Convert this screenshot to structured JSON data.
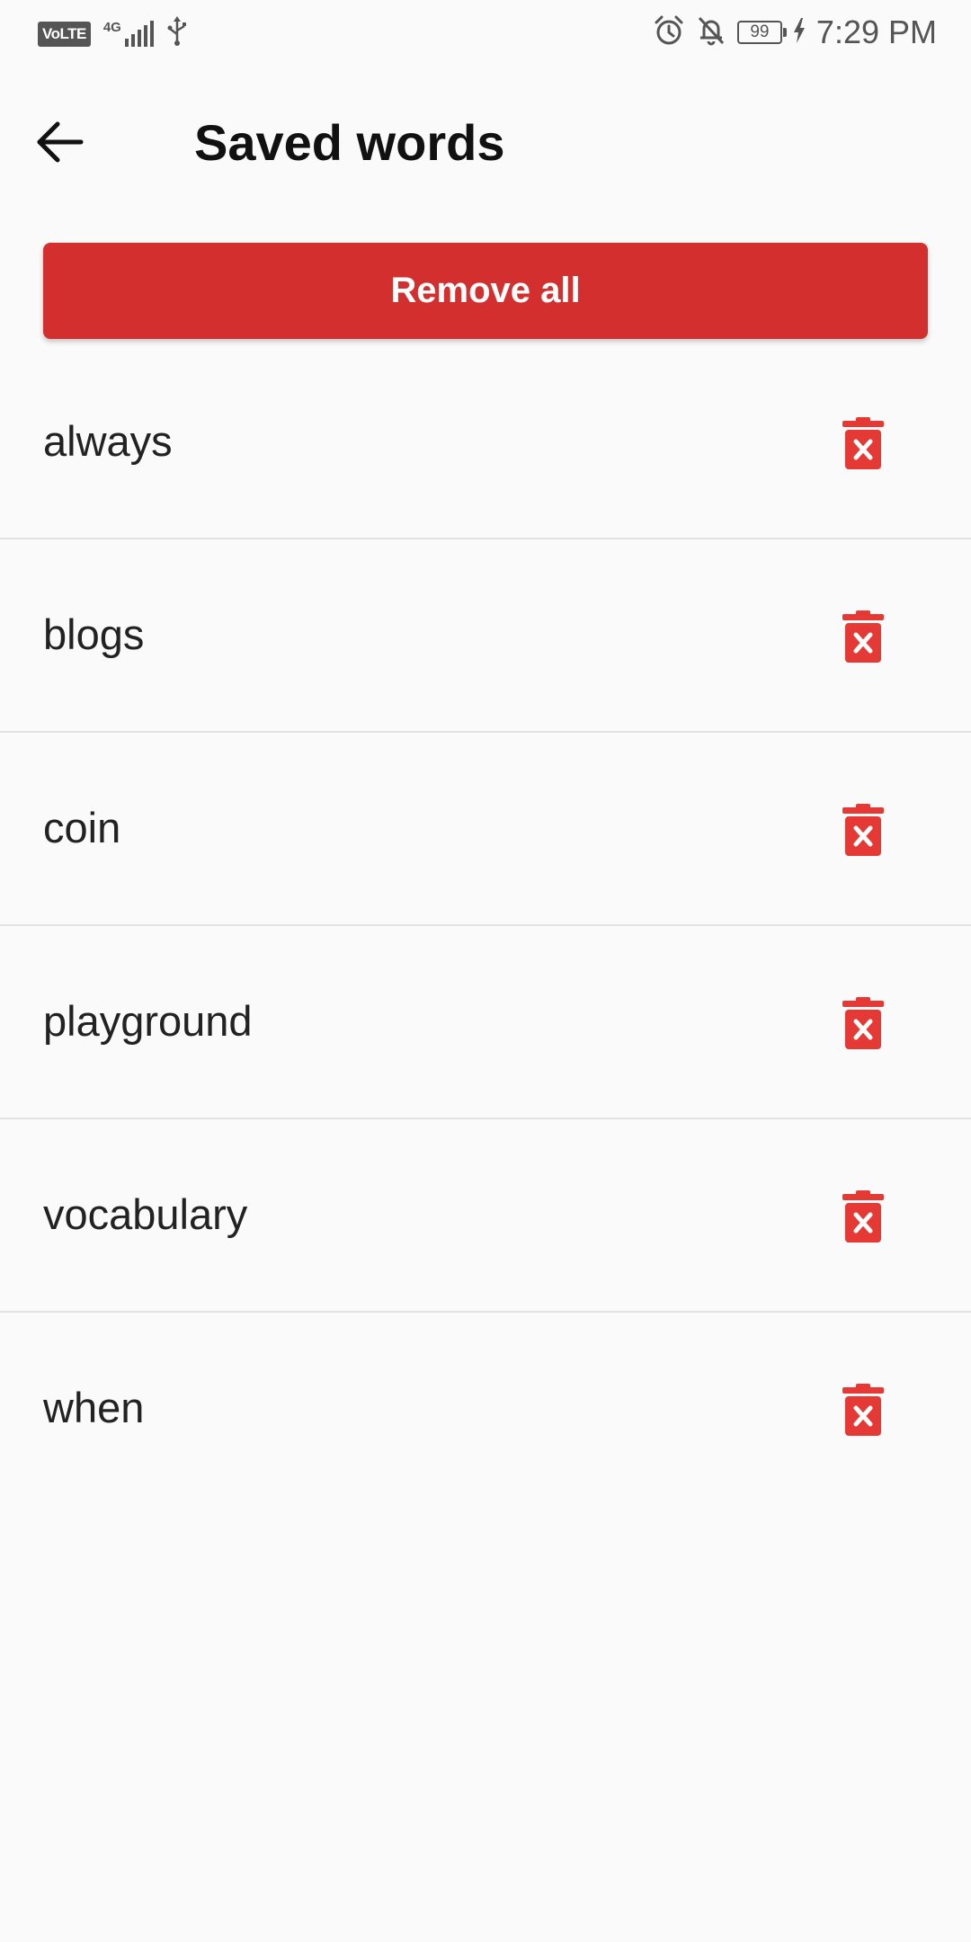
{
  "status_bar": {
    "volte": "VoLTE",
    "network": "4G",
    "battery": "99",
    "time": "7:29 PM"
  },
  "app_bar": {
    "title": "Saved words"
  },
  "actions": {
    "remove_all_label": "Remove all"
  },
  "words": [
    {
      "label": "always"
    },
    {
      "label": "blogs"
    },
    {
      "label": "coin"
    },
    {
      "label": "playground"
    },
    {
      "label": "vocabulary"
    },
    {
      "label": "when"
    }
  ],
  "colors": {
    "accent": "#d32f2f",
    "delete_icon": "#e53935",
    "background": "#fafafa",
    "divider": "#e2e2e2"
  },
  "icons": {
    "back": "arrow-left-icon",
    "delete": "delete-forever-icon",
    "alarm": "alarm-icon",
    "mute": "notifications-off-icon",
    "usb": "usb-icon",
    "signal": "signal-icon",
    "charging": "bolt-icon"
  }
}
